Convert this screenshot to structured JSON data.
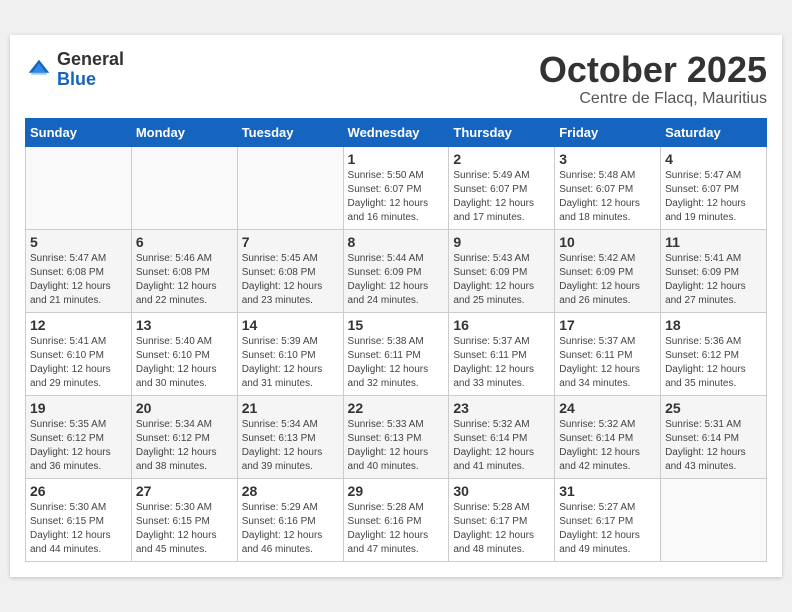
{
  "header": {
    "logo_general": "General",
    "logo_blue": "Blue",
    "month_title": "October 2025",
    "subtitle": "Centre de Flacq, Mauritius"
  },
  "weekdays": [
    "Sunday",
    "Monday",
    "Tuesday",
    "Wednesday",
    "Thursday",
    "Friday",
    "Saturday"
  ],
  "weeks": [
    [
      {
        "day": "",
        "info": ""
      },
      {
        "day": "",
        "info": ""
      },
      {
        "day": "",
        "info": ""
      },
      {
        "day": "1",
        "info": "Sunrise: 5:50 AM\nSunset: 6:07 PM\nDaylight: 12 hours\nand 16 minutes."
      },
      {
        "day": "2",
        "info": "Sunrise: 5:49 AM\nSunset: 6:07 PM\nDaylight: 12 hours\nand 17 minutes."
      },
      {
        "day": "3",
        "info": "Sunrise: 5:48 AM\nSunset: 6:07 PM\nDaylight: 12 hours\nand 18 minutes."
      },
      {
        "day": "4",
        "info": "Sunrise: 5:47 AM\nSunset: 6:07 PM\nDaylight: 12 hours\nand 19 minutes."
      }
    ],
    [
      {
        "day": "5",
        "info": "Sunrise: 5:47 AM\nSunset: 6:08 PM\nDaylight: 12 hours\nand 21 minutes."
      },
      {
        "day": "6",
        "info": "Sunrise: 5:46 AM\nSunset: 6:08 PM\nDaylight: 12 hours\nand 22 minutes."
      },
      {
        "day": "7",
        "info": "Sunrise: 5:45 AM\nSunset: 6:08 PM\nDaylight: 12 hours\nand 23 minutes."
      },
      {
        "day": "8",
        "info": "Sunrise: 5:44 AM\nSunset: 6:09 PM\nDaylight: 12 hours\nand 24 minutes."
      },
      {
        "day": "9",
        "info": "Sunrise: 5:43 AM\nSunset: 6:09 PM\nDaylight: 12 hours\nand 25 minutes."
      },
      {
        "day": "10",
        "info": "Sunrise: 5:42 AM\nSunset: 6:09 PM\nDaylight: 12 hours\nand 26 minutes."
      },
      {
        "day": "11",
        "info": "Sunrise: 5:41 AM\nSunset: 6:09 PM\nDaylight: 12 hours\nand 27 minutes."
      }
    ],
    [
      {
        "day": "12",
        "info": "Sunrise: 5:41 AM\nSunset: 6:10 PM\nDaylight: 12 hours\nand 29 minutes."
      },
      {
        "day": "13",
        "info": "Sunrise: 5:40 AM\nSunset: 6:10 PM\nDaylight: 12 hours\nand 30 minutes."
      },
      {
        "day": "14",
        "info": "Sunrise: 5:39 AM\nSunset: 6:10 PM\nDaylight: 12 hours\nand 31 minutes."
      },
      {
        "day": "15",
        "info": "Sunrise: 5:38 AM\nSunset: 6:11 PM\nDaylight: 12 hours\nand 32 minutes."
      },
      {
        "day": "16",
        "info": "Sunrise: 5:37 AM\nSunset: 6:11 PM\nDaylight: 12 hours\nand 33 minutes."
      },
      {
        "day": "17",
        "info": "Sunrise: 5:37 AM\nSunset: 6:11 PM\nDaylight: 12 hours\nand 34 minutes."
      },
      {
        "day": "18",
        "info": "Sunrise: 5:36 AM\nSunset: 6:12 PM\nDaylight: 12 hours\nand 35 minutes."
      }
    ],
    [
      {
        "day": "19",
        "info": "Sunrise: 5:35 AM\nSunset: 6:12 PM\nDaylight: 12 hours\nand 36 minutes."
      },
      {
        "day": "20",
        "info": "Sunrise: 5:34 AM\nSunset: 6:12 PM\nDaylight: 12 hours\nand 38 minutes."
      },
      {
        "day": "21",
        "info": "Sunrise: 5:34 AM\nSunset: 6:13 PM\nDaylight: 12 hours\nand 39 minutes."
      },
      {
        "day": "22",
        "info": "Sunrise: 5:33 AM\nSunset: 6:13 PM\nDaylight: 12 hours\nand 40 minutes."
      },
      {
        "day": "23",
        "info": "Sunrise: 5:32 AM\nSunset: 6:14 PM\nDaylight: 12 hours\nand 41 minutes."
      },
      {
        "day": "24",
        "info": "Sunrise: 5:32 AM\nSunset: 6:14 PM\nDaylight: 12 hours\nand 42 minutes."
      },
      {
        "day": "25",
        "info": "Sunrise: 5:31 AM\nSunset: 6:14 PM\nDaylight: 12 hours\nand 43 minutes."
      }
    ],
    [
      {
        "day": "26",
        "info": "Sunrise: 5:30 AM\nSunset: 6:15 PM\nDaylight: 12 hours\nand 44 minutes."
      },
      {
        "day": "27",
        "info": "Sunrise: 5:30 AM\nSunset: 6:15 PM\nDaylight: 12 hours\nand 45 minutes."
      },
      {
        "day": "28",
        "info": "Sunrise: 5:29 AM\nSunset: 6:16 PM\nDaylight: 12 hours\nand 46 minutes."
      },
      {
        "day": "29",
        "info": "Sunrise: 5:28 AM\nSunset: 6:16 PM\nDaylight: 12 hours\nand 47 minutes."
      },
      {
        "day": "30",
        "info": "Sunrise: 5:28 AM\nSunset: 6:17 PM\nDaylight: 12 hours\nand 48 minutes."
      },
      {
        "day": "31",
        "info": "Sunrise: 5:27 AM\nSunset: 6:17 PM\nDaylight: 12 hours\nand 49 minutes."
      },
      {
        "day": "",
        "info": ""
      }
    ]
  ]
}
